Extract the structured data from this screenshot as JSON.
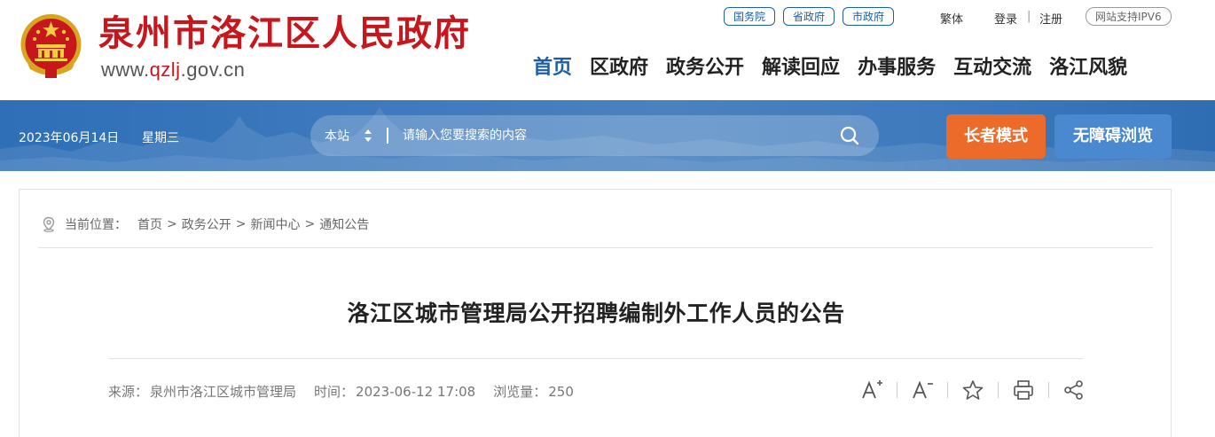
{
  "header": {
    "site_title": "泉州市洛江区人民政府",
    "url_prefix": "www.",
    "url_highlight": "qzlj",
    "url_suffix": ".gov.cn",
    "quick_links": [
      "国务院",
      "省政府",
      "市政府"
    ],
    "traditional": "繁体",
    "login": "登录",
    "separator": "|",
    "register": "注册",
    "ipv6": "网站支持IPV6",
    "nav": [
      "首页",
      "区政府",
      "政务公开",
      "解读回应",
      "办事服务",
      "互动交流",
      "洛江风貌"
    ],
    "nav_active_index": 0
  },
  "banner": {
    "date": "2023年06月14日",
    "weekday": "星期三",
    "search_scope": "本站",
    "search_placeholder": "请输入您要搜索的内容",
    "elder_mode": "长者模式",
    "accessible": "无障碍浏览"
  },
  "breadcrumb": {
    "label": "当前位置：",
    "items": [
      "首页",
      "政务公开",
      "新闻中心",
      "通知公告"
    ],
    "separator": ">"
  },
  "article": {
    "title": "洛江区城市管理局公开招聘编制外工作人员的公告",
    "source_label": "来源：",
    "source": "泉州市洛江区城市管理局",
    "time_label": "时间：",
    "time": "2023-06-12 17:08",
    "views_label": "浏览量：",
    "views": "250"
  },
  "tools": [
    "font-increase-icon",
    "font-decrease-icon",
    "favorite-star-icon",
    "print-icon",
    "share-icon"
  ],
  "colors": {
    "brand_red": "#c8161d",
    "brand_blue": "#1c5ea8",
    "elder_orange": "#ec6a2a",
    "access_blue": "#4a88d0"
  }
}
